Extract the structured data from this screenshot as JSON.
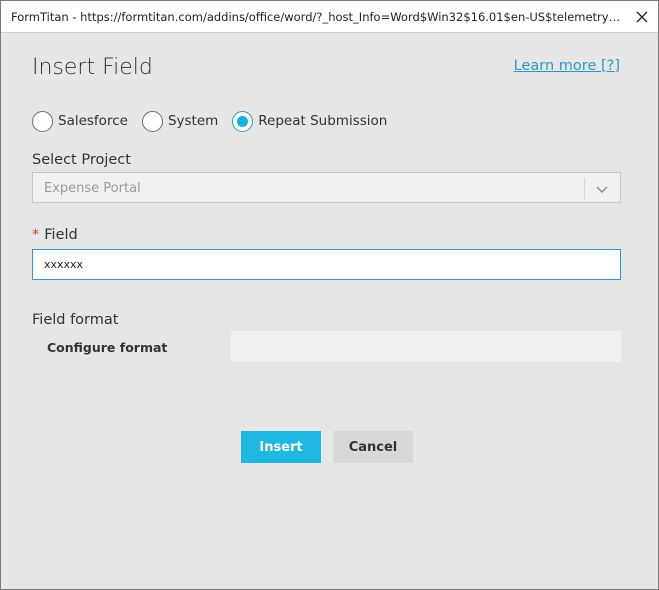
{
  "window": {
    "title": "FormTitan - https://formtitan.com/addins/office/word/?_host_Info=Word$Win32$16.01$en-US$telemetry$isDialog..."
  },
  "dialog": {
    "heading": "Insert Field",
    "learn_more": "Learn more [?]"
  },
  "source_options": [
    {
      "label": "Salesforce",
      "checked": false
    },
    {
      "label": "System",
      "checked": false
    },
    {
      "label": "Repeat Submission",
      "checked": true
    }
  ],
  "project": {
    "label": "Select Project",
    "value": "Expense Portal"
  },
  "field": {
    "required_mark": "*",
    "label": "Field",
    "value": "xxxxxx"
  },
  "format": {
    "label": "Field format",
    "configure_label": "Configure format",
    "configure_value": ""
  },
  "buttons": {
    "insert": "Insert",
    "cancel": "Cancel"
  },
  "colors": {
    "accent": "#1fb8e3",
    "link": "#2b9ac8",
    "required": "#d13438"
  }
}
